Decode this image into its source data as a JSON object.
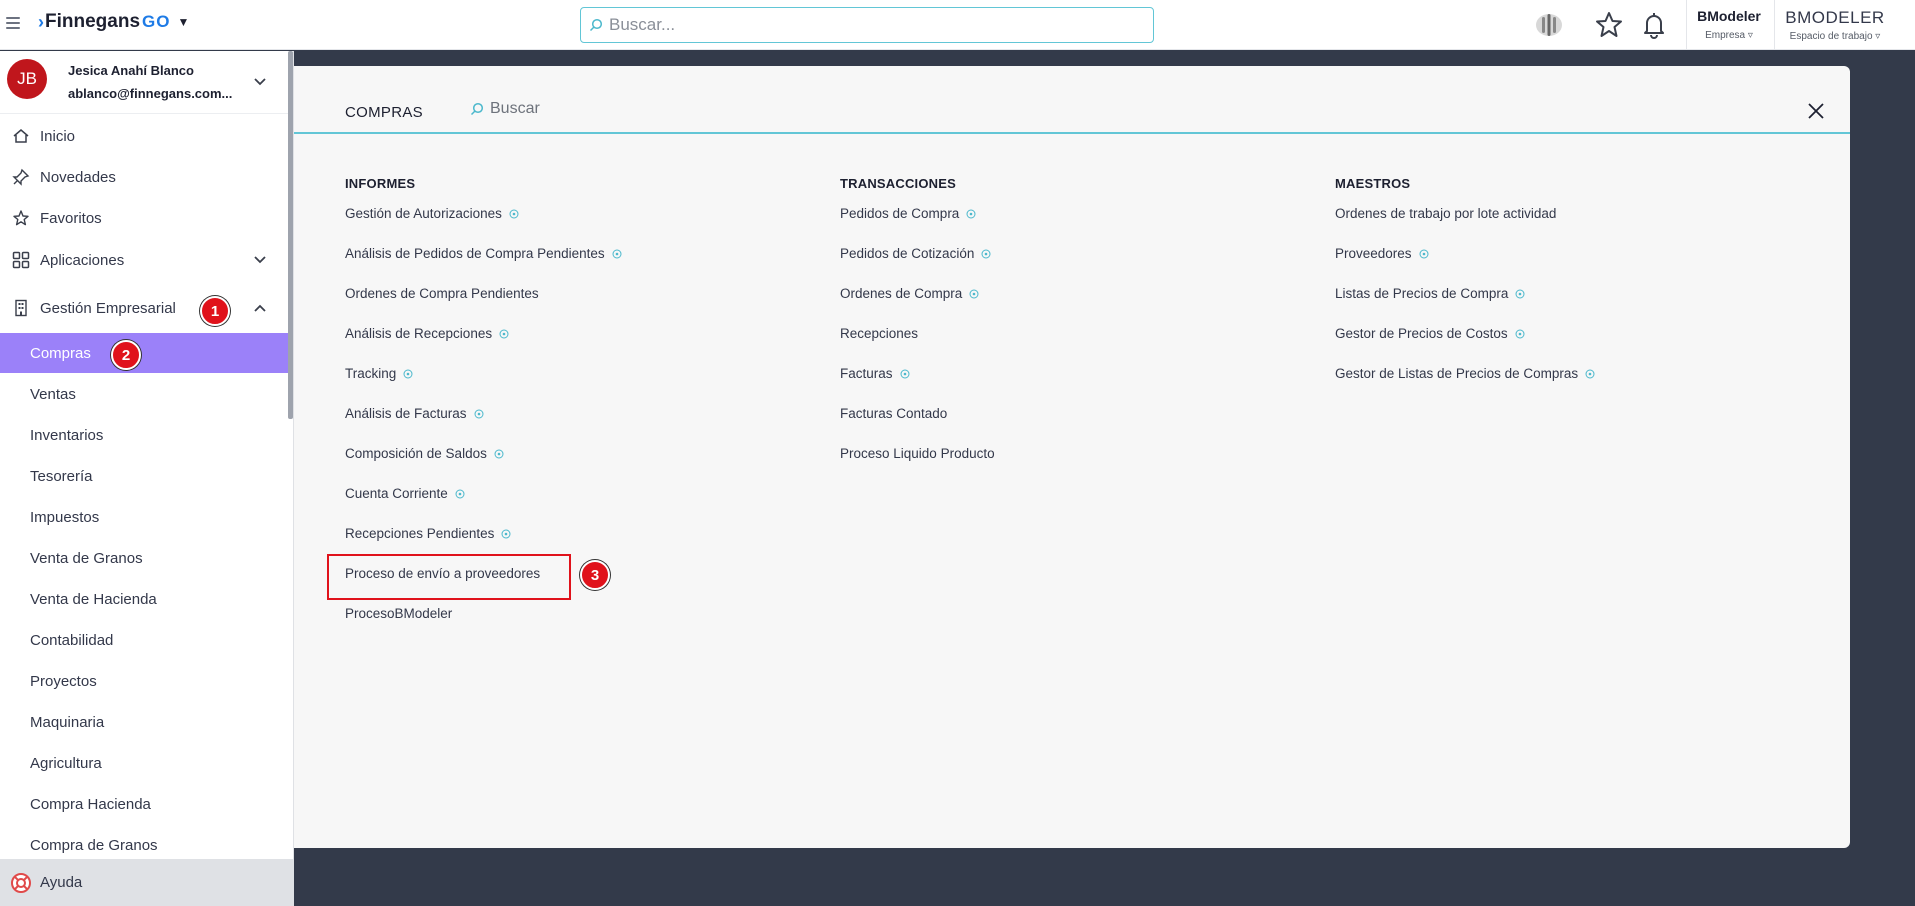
{
  "topbar": {
    "brand": "Finnegans",
    "brand_suffix": "GO",
    "search_placeholder": "Buscar...",
    "company_name": "BModeler",
    "company_label": "Empresa",
    "workspace_name": "BMODELER",
    "workspace_label": "Espacio de trabajo"
  },
  "user": {
    "initials": "JB",
    "name": "Jesica Anahí Blanco",
    "email": "ablanco@finnegans.com..."
  },
  "sidebar": {
    "items": [
      {
        "label": "Inicio",
        "icon": "home-icon"
      },
      {
        "label": "Novedades",
        "icon": "pin-icon"
      },
      {
        "label": "Favoritos",
        "icon": "star-icon"
      },
      {
        "label": "Aplicaciones",
        "icon": "grid-icon"
      },
      {
        "label": "Gestión Empresarial",
        "icon": "building-icon"
      }
    ],
    "subitems": [
      "Compras",
      "Ventas",
      "Inventarios",
      "Tesorería",
      "Impuestos",
      "Venta de Granos",
      "Venta de Hacienda",
      "Contabilidad",
      "Proyectos",
      "Maquinaria",
      "Agricultura",
      "Compra Hacienda",
      "Compra de Granos"
    ],
    "active_subitem": "Compras",
    "help_label": "Ayuda"
  },
  "panel": {
    "title": "COMPRAS",
    "search_placeholder": "Buscar",
    "columns": [
      {
        "title": "INFORMES",
        "links": [
          {
            "label": "Gestión de Autorizaciones",
            "info": true
          },
          {
            "label": "Análisis de Pedidos de Compra Pendientes",
            "info": true
          },
          {
            "label": "Ordenes de Compra Pendientes",
            "info": false
          },
          {
            "label": "Análisis de Recepciones",
            "info": true
          },
          {
            "label": "Tracking",
            "info": true
          },
          {
            "label": "Análisis de Facturas",
            "info": true
          },
          {
            "label": "Composición de Saldos",
            "info": true
          },
          {
            "label": "Cuenta Corriente",
            "info": true
          },
          {
            "label": "Recepciones Pendientes",
            "info": true
          },
          {
            "label": "Proceso de envío a proveedores",
            "info": false
          },
          {
            "label": "ProcesoBModeler",
            "info": false
          }
        ]
      },
      {
        "title": "TRANSACCIONES",
        "links": [
          {
            "label": "Pedidos de Compra",
            "info": true
          },
          {
            "label": "Pedidos de Cotización",
            "info": true
          },
          {
            "label": "Ordenes de Compra",
            "info": true
          },
          {
            "label": "Recepciones",
            "info": false
          },
          {
            "label": "Facturas",
            "info": true
          },
          {
            "label": "Facturas Contado",
            "info": false
          },
          {
            "label": "Proceso Liquido Producto",
            "info": false
          }
        ]
      },
      {
        "title": "MAESTROS",
        "links": [
          {
            "label": "Ordenes de trabajo por lote actividad",
            "info": false
          },
          {
            "label": "Proveedores",
            "info": true
          },
          {
            "label": "Listas de Precios de Compra",
            "info": true
          },
          {
            "label": "Gestor de Precios de Costos",
            "info": true
          },
          {
            "label": "Gestor de Listas de Precios de Compras",
            "info": true
          }
        ]
      }
    ]
  },
  "markers": [
    "1",
    "2",
    "3"
  ],
  "colors": {
    "accent": "#1e7be6",
    "active_item": "#9b81f9",
    "marker": "#e0121b",
    "search_border": "#62c6d6",
    "backdrop": "#333a4a"
  }
}
